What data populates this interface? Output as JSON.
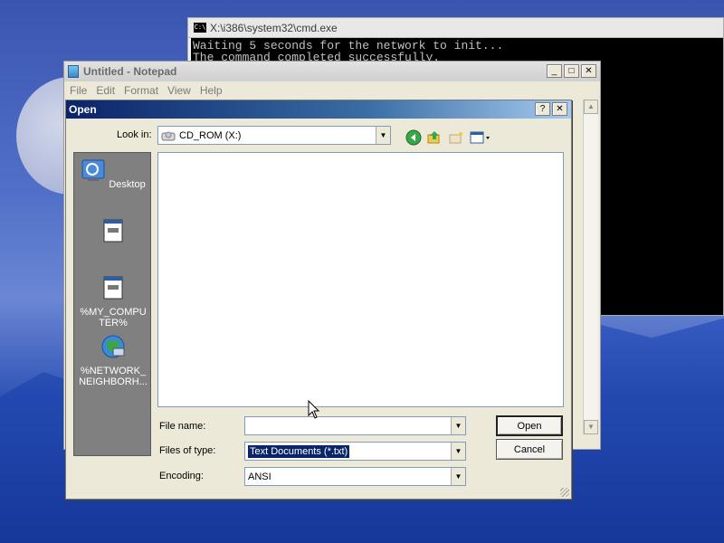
{
  "desktop": {
    "background": "#3a5ec4"
  },
  "cmd": {
    "title": "X:\\i386\\system32\\cmd.exe",
    "lines": [
      "Waiting 5 seconds for the network to init...",
      "The command completed successfully."
    ]
  },
  "notepad": {
    "title": "Untitled - Notepad",
    "menu": [
      "File",
      "Edit",
      "Format",
      "View",
      "Help"
    ]
  },
  "dialog": {
    "title": "Open",
    "look_in_label": "Look in:",
    "look_in_value": "CD_ROM (X:)",
    "places": [
      {
        "label": "Desktop",
        "icon": "desktop-icon"
      },
      {
        "label": "",
        "icon": "document-icon"
      },
      {
        "label": "%MY_COMPUTER%",
        "icon": "computer-icon"
      },
      {
        "label": "%NETWORK_NEIGHBORH...",
        "icon": "network-icon"
      }
    ],
    "file_name_label": "File name:",
    "file_name_value": "",
    "files_of_type_label": "Files of type:",
    "files_of_type_value": "Text Documents (*.txt)",
    "encoding_label": "Encoding:",
    "encoding_value": "ANSI",
    "open_button": "Open",
    "cancel_button": "Cancel"
  }
}
